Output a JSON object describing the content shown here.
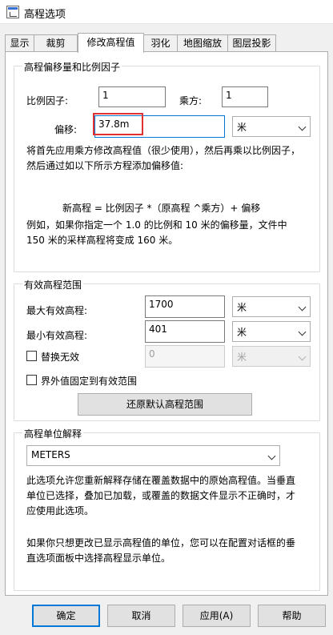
{
  "window": {
    "title": "高程选项",
    "icon": "app-window-icon"
  },
  "tabs": [
    {
      "label": "显示"
    },
    {
      "label": "裁剪"
    },
    {
      "label": "修改高程值"
    },
    {
      "label": "羽化"
    },
    {
      "label": "地图缩放"
    },
    {
      "label": "图层投影"
    }
  ],
  "offset_group": {
    "title": "高程偏移量和比例因子",
    "scale_label": "比例因子:",
    "scale_value": "1",
    "power_label": "乘方:",
    "power_value": "1",
    "offset_label": "偏移:",
    "offset_value": "37.8m",
    "offset_unit": "米",
    "desc1_line1": "将首先应用乘方修改高程值（很少使用），然后再乘以比例因子，",
    "desc1_line2": "然后通过如以下所示方程添加偏移值:",
    "formula": "新高程 = 比例因子 *（原高程 ^乘方）+ 偏移",
    "desc2_line1": "例如，如果你指定一个 1.0 的比例和 10 米的偏移量，文件中",
    "desc2_line2": "150 米的采样高程将变成 160 米。"
  },
  "range_group": {
    "title": "有效高程范围",
    "max_label": "最大有效高程:",
    "max_value": "1700",
    "max_unit": "米",
    "min_label": "最小有效高程:",
    "min_value": "401",
    "min_unit": "米",
    "replace_label": "替换无效",
    "replace_value": "0",
    "replace_unit": "米",
    "clamp_label": "界外值固定到有效范围",
    "restore_button": "还原默认高程范围"
  },
  "units_group": {
    "title": "高程单位解释",
    "selected": "METERS",
    "desc1_line1": "此选项允许您重新解释存储在覆盖数据中的原始高程值。当垂直",
    "desc1_line2": "单位已选择，叠加已加载，或覆盖的数据文件显示不正确时，才",
    "desc1_line3": "应使用此选项。",
    "desc2_line1": "如果你只想更改已显示高程值的单位，您可以在配置对话框的垂",
    "desc2_line2": "直选项面板中选择高程显示单位。"
  },
  "buttons": {
    "ok": "确定",
    "cancel": "取消",
    "apply": "应用(A)",
    "help": "帮助"
  },
  "colors": {
    "highlight": "#e03030",
    "focus": "#0078d7"
  }
}
